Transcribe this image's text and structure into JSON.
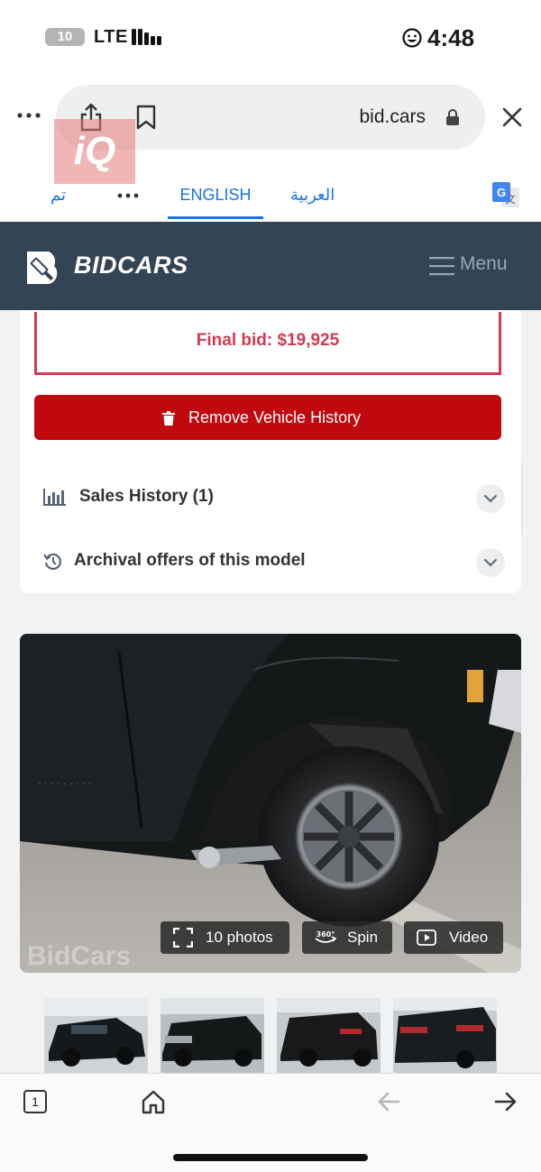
{
  "status_bar": {
    "battery": "10",
    "network": "LTE",
    "time": "4:48"
  },
  "browser": {
    "url": "bid.cars",
    "icons": [
      "more-dots-icon",
      "share-icon",
      "bookmark-icon",
      "lock-icon",
      "close-icon"
    ]
  },
  "translate_bar": {
    "done_label": "تم",
    "english_label": "ENGLISH",
    "arabic_label": "العربية",
    "active": "ENGLISH"
  },
  "site_header": {
    "brand": "BIDCARS",
    "menu_label": "Menu"
  },
  "auction": {
    "final_bid": "Final bid: $19,925",
    "remove_history_label": "Remove Vehicle History",
    "sections": [
      {
        "label": "Sales History (1)",
        "icon": "bar-chart-icon"
      },
      {
        "label": "Archival offers of this model",
        "icon": "history-icon"
      }
    ]
  },
  "gallery": {
    "photos_label": "10 photos",
    "spin_label": "Spin",
    "video_label": "Video",
    "spin_badge": "360°",
    "watermark": "BidCars"
  },
  "toolbar": {
    "tab_count": "1"
  },
  "colors": {
    "header_bg": "#334455",
    "accent_red": "#c0090f",
    "bid_red": "#d23a52",
    "link_blue": "#1a73e8",
    "page_bg": "#f1f2f4"
  }
}
